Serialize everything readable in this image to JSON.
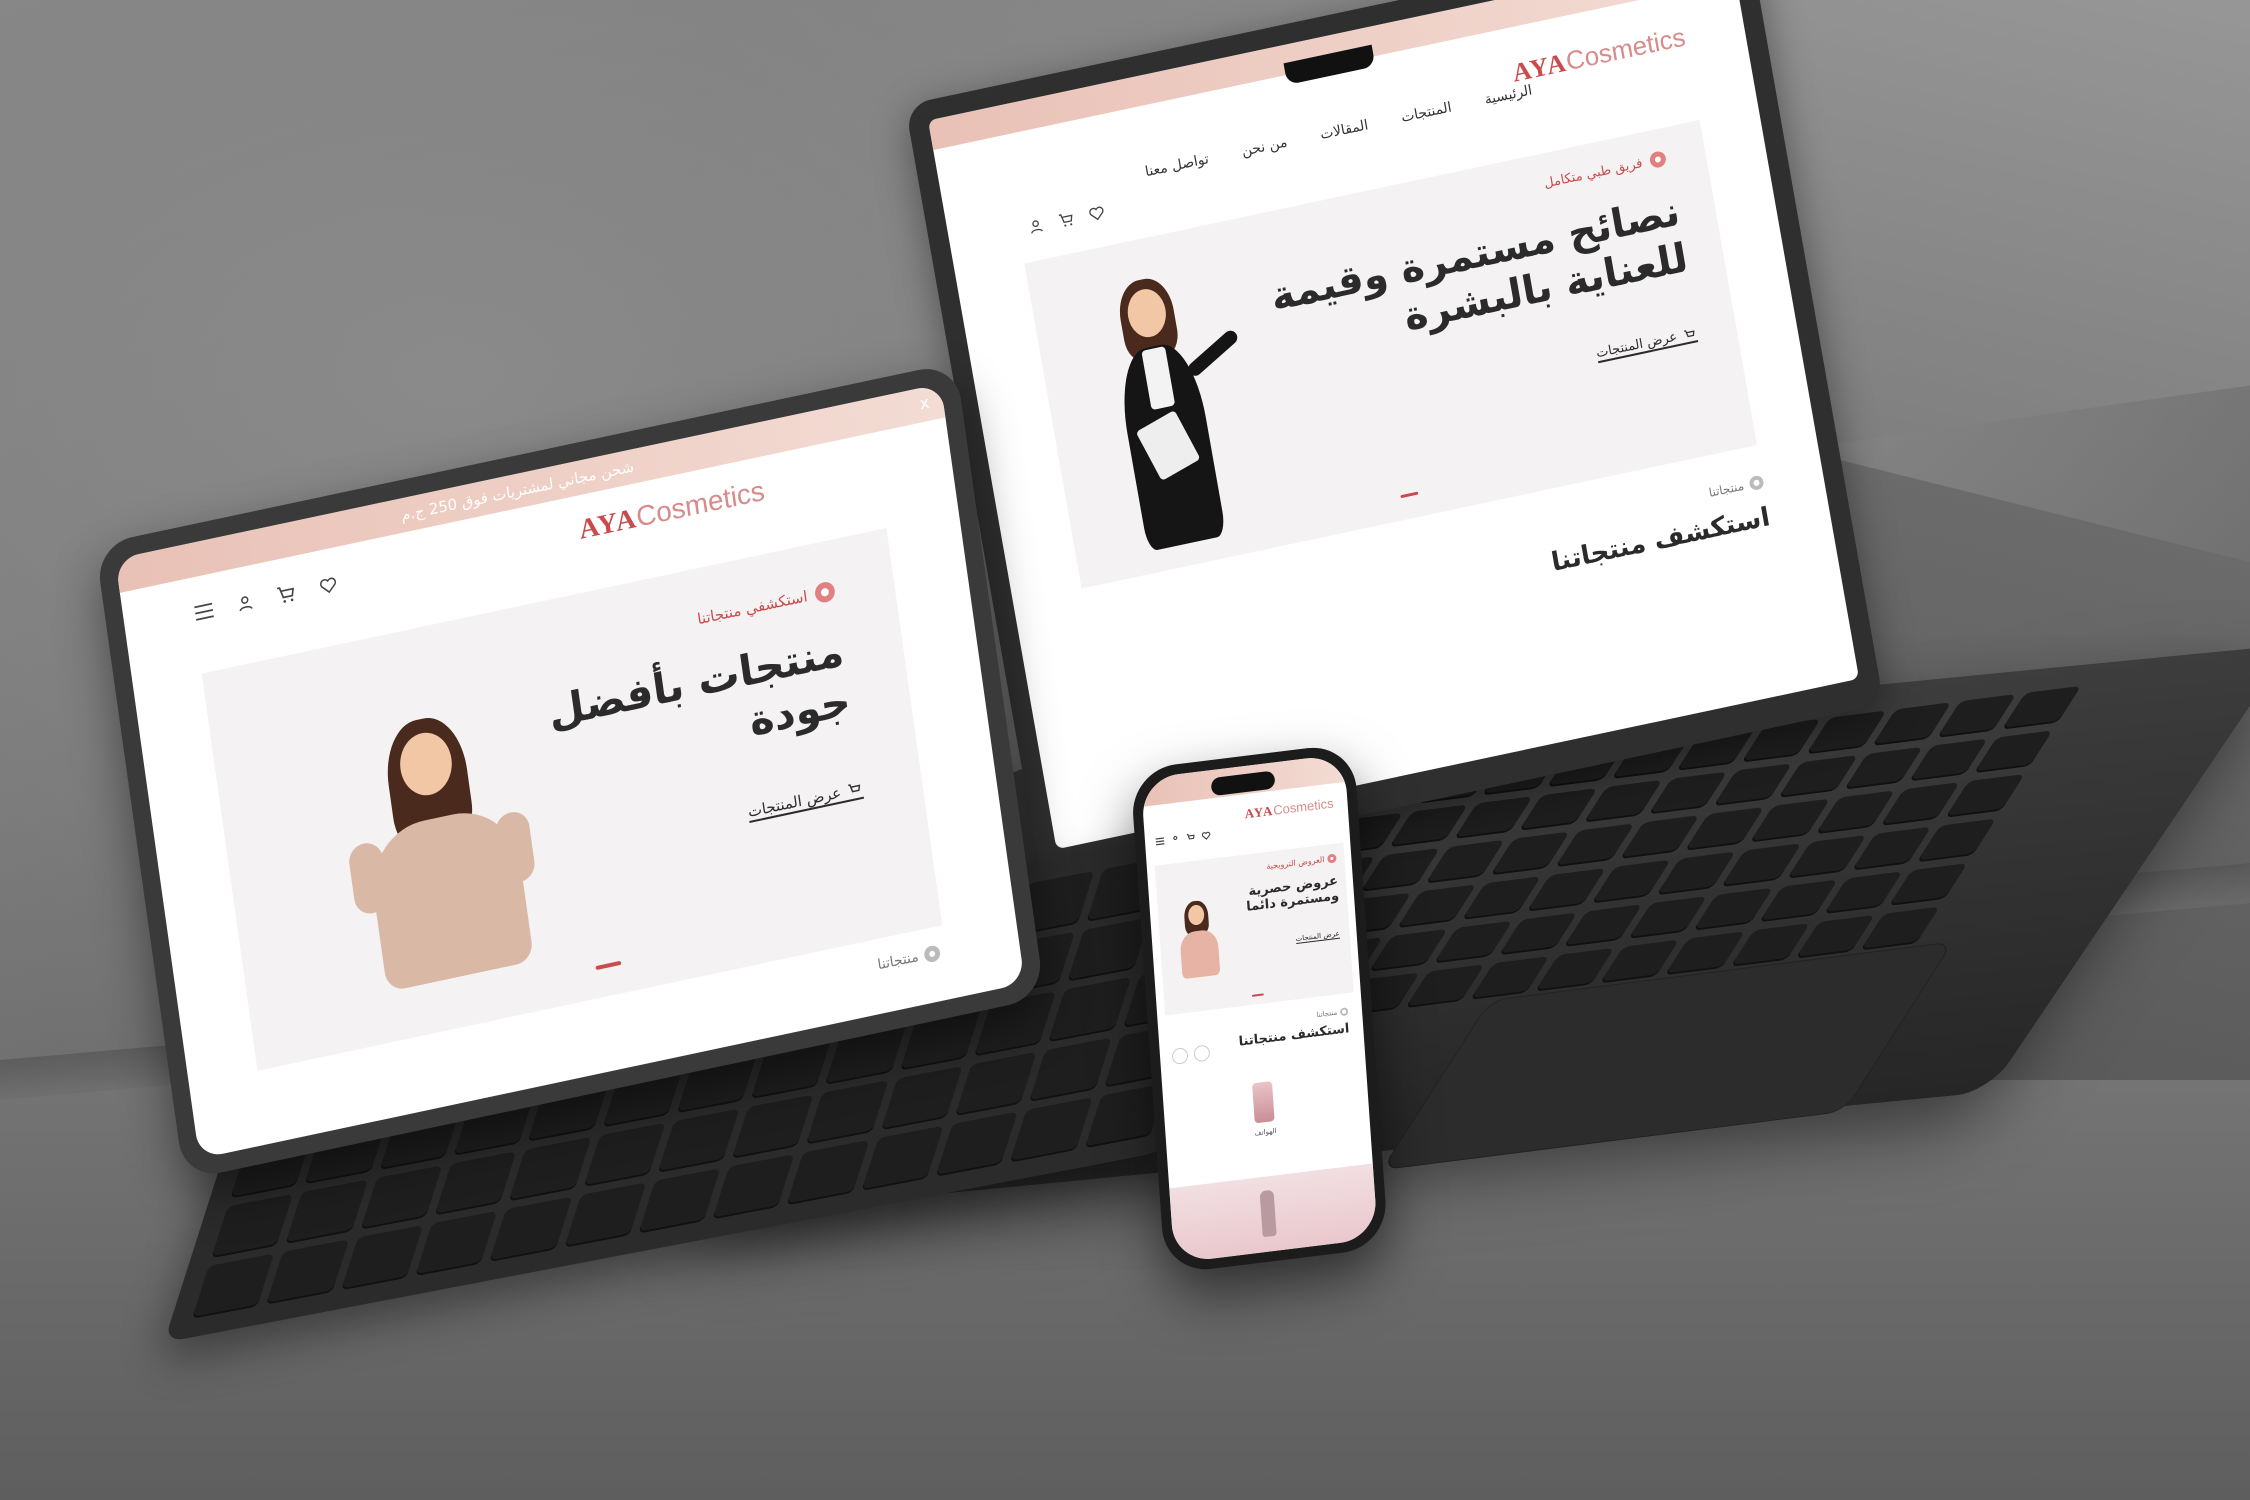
{
  "brand": {
    "logo_main": "AYA",
    "logo_rest": "Cosmetics"
  },
  "colors": {
    "accent": "#c94b4b",
    "band": "#e9c1b6",
    "text": "#2b2b2b"
  },
  "laptop": {
    "nav": [
      "الرئيسية",
      "المنتجات",
      "المقالات",
      "من نحن",
      "تواصل معنا"
    ],
    "badge": "فريق طبي متكامل",
    "hero_line1": "نصائح مستمرة وقيمة",
    "hero_line2": "للعناية بالبشرة",
    "cta": "عرض المنتجات",
    "section_small": "منتجاتنا",
    "section_title": "استكشف منتجاتنا",
    "close": "x"
  },
  "tablet": {
    "promo": "شحن مجاني لمشتريات فوق 250 ج.م",
    "badge": "استكشفي منتجاتنا",
    "hero_line1": "منتجات بأفضل",
    "hero_line2": "جودة",
    "cta": "عرض المنتجات",
    "section_small": "منتجاتنا",
    "close": "x"
  },
  "phone": {
    "badge": "العروض الترويجية",
    "hero_line1": "عروض حصرية",
    "hero_line2": "ومستمرة دائما",
    "cta": "عرض المنتجات",
    "section_small": "منتجاتنا",
    "section_title": "استكشف منتجاتنا",
    "product_label": "الهواتف"
  },
  "icons": [
    "heart-icon",
    "cart-icon",
    "user-icon",
    "menu-icon",
    "close-icon",
    "badge-icon"
  ]
}
